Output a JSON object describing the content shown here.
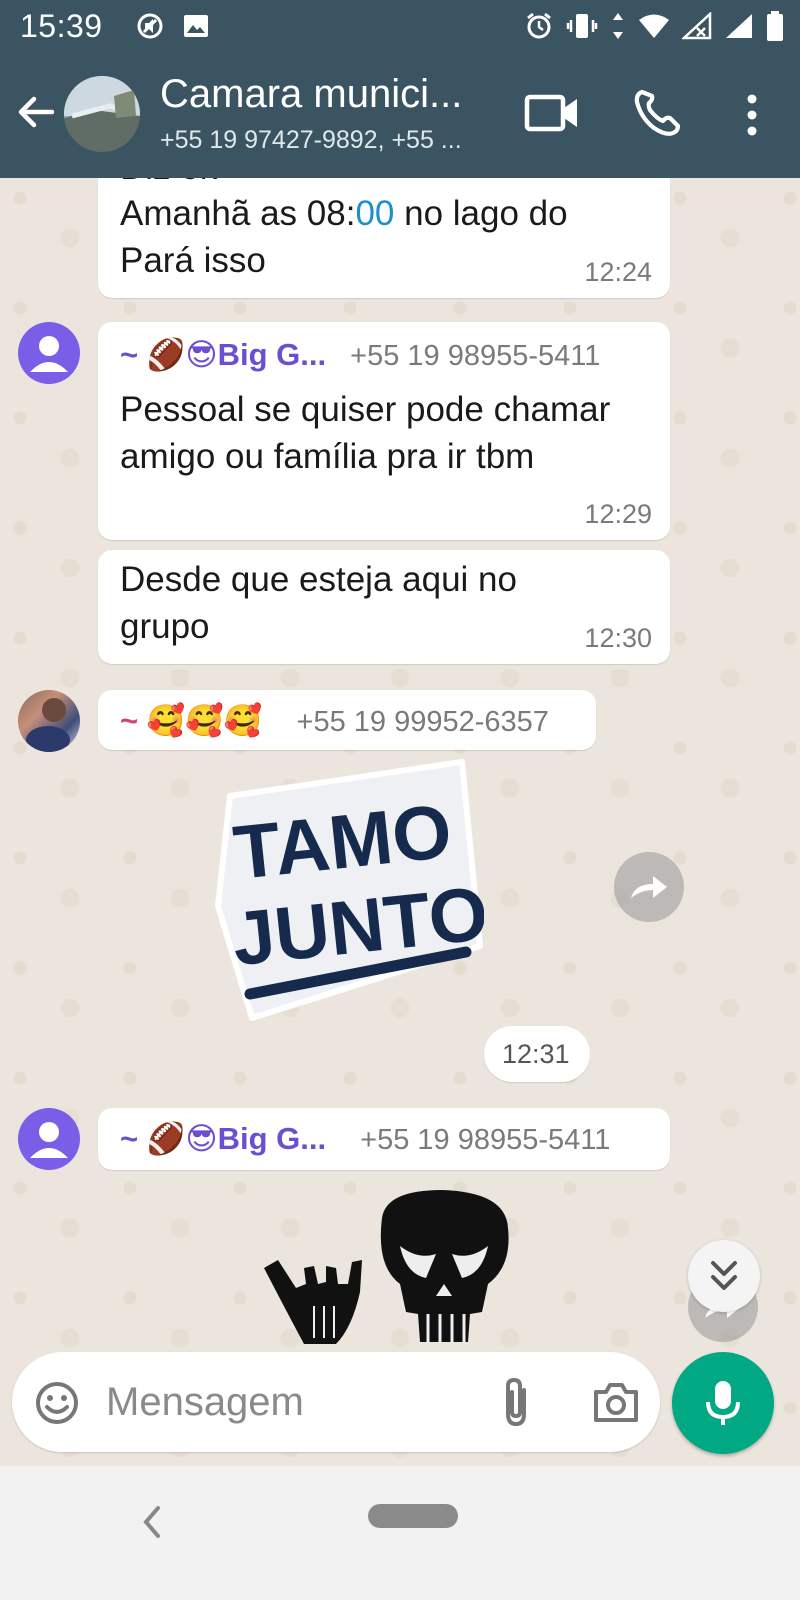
{
  "status_bar": {
    "time": "15:39",
    "left_icons": [
      "mute-icon",
      "image-icon"
    ],
    "right_icons": [
      "alarm-icon",
      "vibrate-icon",
      "data-arrows-icon",
      "wifi-icon",
      "signal-x-icon",
      "signal-icon",
      "battery-icon"
    ]
  },
  "header": {
    "title": "Camara munici...",
    "subtitle": "+55 19 97427-9892, +55 ...",
    "icons": [
      "back-arrow-icon",
      "video-call-icon",
      "phone-icon",
      "more-vert-icon"
    ]
  },
  "messages": [
    {
      "partial_top_text": "Diz ok",
      "text_parts": [
        "Amanhã as 08:",
        "00",
        " no lago do Pará isso"
      ],
      "time": "12:24"
    },
    {
      "sender": "~ 🏈😎Big G...",
      "phone": "+55 19 98955-5411",
      "text": "Pessoal se quiser pode chamar amigo ou família pra ir tbm",
      "time": "12:29"
    },
    {
      "text": "Desde que esteja aqui no grupo",
      "time": "12:30"
    },
    {
      "sender": "~ 🥰🥰🥰",
      "phone": "+55 19 99952-6357",
      "sticker_lines": [
        "TAMO",
        "JUNTO"
      ],
      "time": "12:31"
    },
    {
      "sender": "~ 🏈😎Big G...",
      "phone": "+55 19 98955-5411",
      "sticker": "shaka-hand-and-punisher-skull"
    }
  ],
  "input_bar": {
    "placeholder": "Mensagem",
    "icons": [
      "emoji-icon",
      "attach-icon",
      "camera-icon",
      "mic-icon"
    ]
  },
  "colors": {
    "header_bg": "#3b5461",
    "chat_bg": "#ece5dd",
    "sender_name": "#6a4fcf",
    "link_digit": "#1f8fc7",
    "mic_bg": "#00a884"
  }
}
